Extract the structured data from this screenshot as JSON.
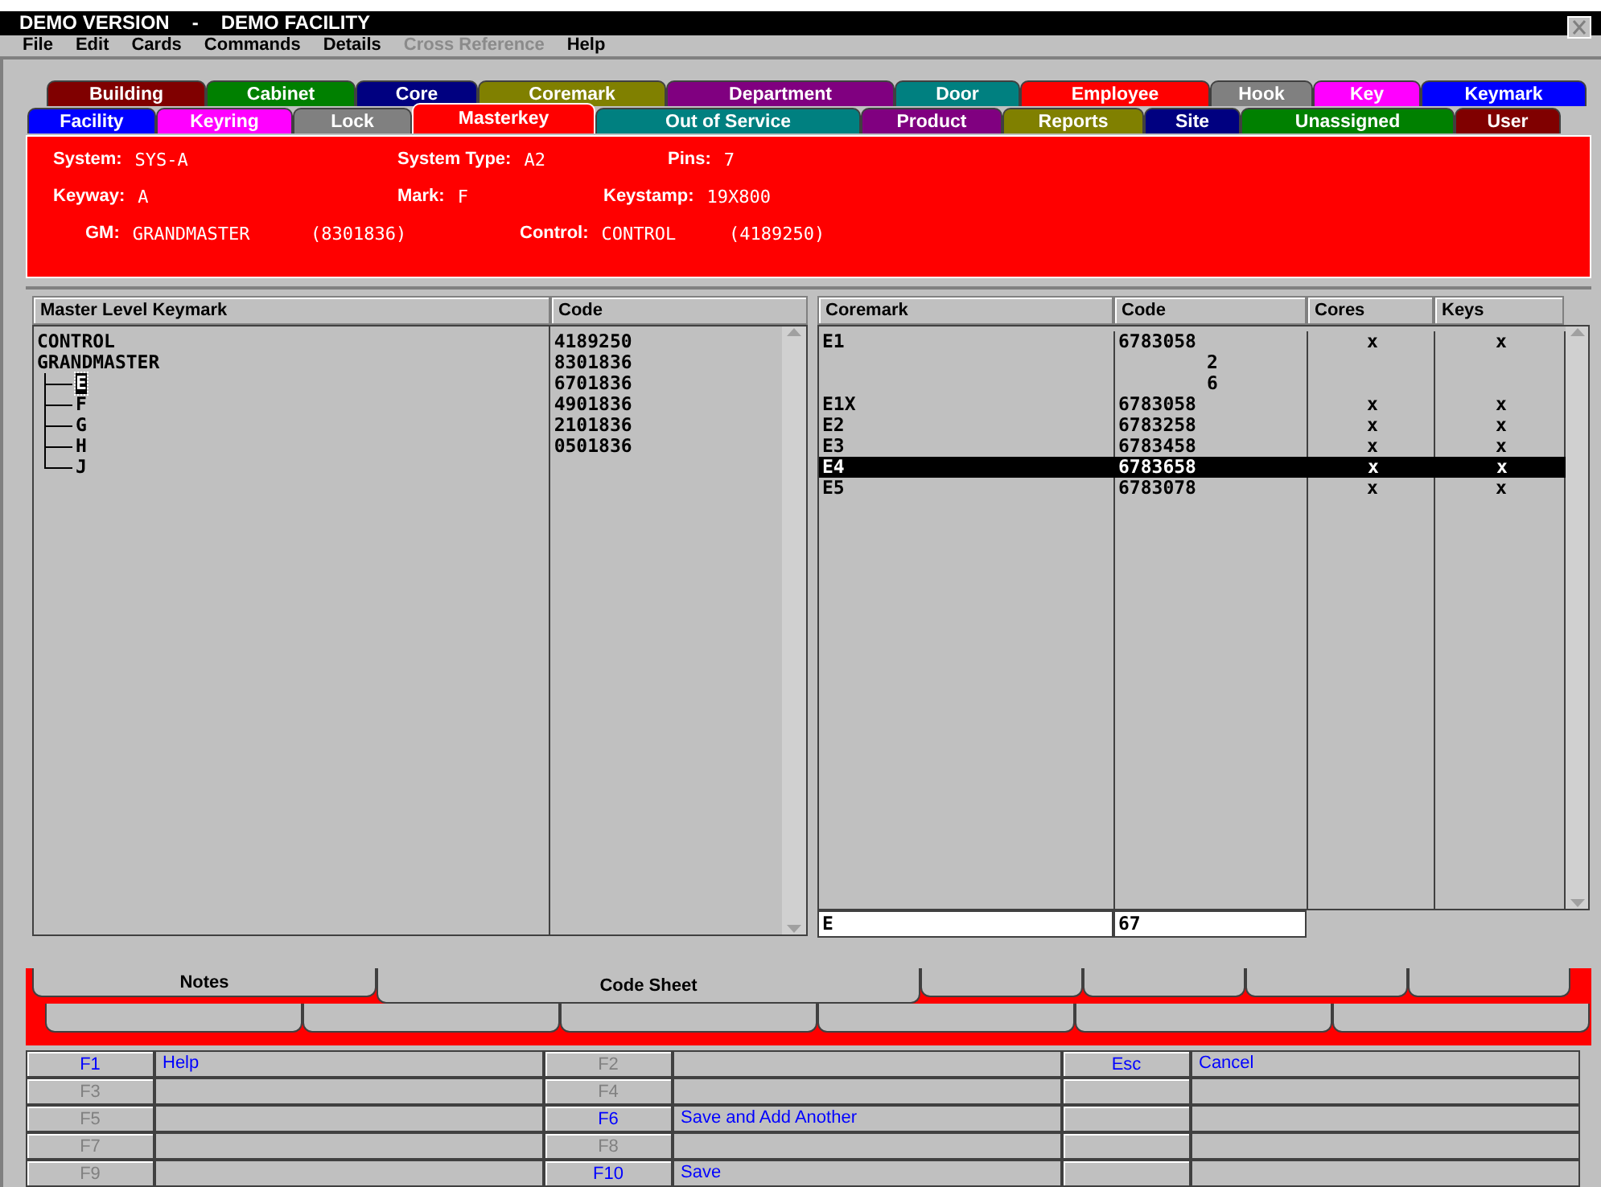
{
  "window": {
    "title_left": "DEMO VERSION",
    "separator": "-",
    "title_right": "DEMO FACILITY"
  },
  "menu": [
    {
      "label": "File",
      "disabled": false
    },
    {
      "label": "Edit",
      "disabled": false
    },
    {
      "label": "Cards",
      "disabled": false
    },
    {
      "label": "Commands",
      "disabled": false
    },
    {
      "label": "Details",
      "disabled": false
    },
    {
      "label": "Cross Reference",
      "disabled": true
    },
    {
      "label": "Help",
      "disabled": false
    }
  ],
  "tab_rows": [
    [
      {
        "label": "Building",
        "color": "#800000",
        "selected": false
      },
      {
        "label": "Cabinet",
        "color": "#008000",
        "selected": false
      },
      {
        "label": "Core",
        "color": "#000080",
        "selected": false
      },
      {
        "label": "Coremark",
        "color": "#808000",
        "selected": false
      },
      {
        "label": "Department",
        "color": "#800080",
        "selected": false
      },
      {
        "label": "Door",
        "color": "#008080",
        "selected": false
      },
      {
        "label": "Employee",
        "color": "#ff0000",
        "selected": false
      },
      {
        "label": "Hook",
        "color": "#808080",
        "selected": false
      },
      {
        "label": "Key",
        "color": "#ff00ff",
        "selected": false
      },
      {
        "label": "Keymark",
        "color": "#0000ff",
        "selected": false
      }
    ],
    [
      {
        "label": "Facility",
        "color": "#0000ff",
        "selected": false
      },
      {
        "label": "Keyring",
        "color": "#ff00ff",
        "selected": false
      },
      {
        "label": "Lock",
        "color": "#808080",
        "selected": false
      },
      {
        "label": "Masterkey",
        "color": "#ff0000",
        "selected": true
      },
      {
        "label": "Out of Service",
        "color": "#008080",
        "selected": false
      },
      {
        "label": "Product",
        "color": "#800080",
        "selected": false
      },
      {
        "label": "Reports",
        "color": "#808000",
        "selected": false
      },
      {
        "label": "Site",
        "color": "#000080",
        "selected": false
      },
      {
        "label": "Unassigned",
        "color": "#008000",
        "selected": false
      },
      {
        "label": "User",
        "color": "#800000",
        "selected": false
      }
    ]
  ],
  "info": [
    [
      {
        "label": "System:",
        "value": "SYS-A"
      },
      {
        "label": "System Type:",
        "value": "A2"
      },
      {
        "label": "Pins:",
        "value": "7"
      }
    ],
    [
      {
        "label": "Keyway:",
        "value": "A"
      },
      {
        "label": "Mark:",
        "value": "F"
      },
      {
        "label": "Keystamp:",
        "value": "19X800"
      }
    ],
    [
      {
        "label": "GM:",
        "value": "GRANDMASTER",
        "code": "(8301836)"
      },
      {
        "label": "Control:",
        "value": "CONTROL",
        "code": "(4189250)"
      }
    ]
  ],
  "keymark_list": {
    "columns": [
      "Master Level Keymark",
      "Code"
    ],
    "tree": [
      {
        "name": "CONTROL",
        "code": "4189250",
        "selected": false
      },
      {
        "name": "GRANDMASTER",
        "code": "8301836",
        "selected": false,
        "children": [
          {
            "name": "E",
            "code": "6701836",
            "selected": true
          },
          {
            "name": "F",
            "code": "4901836",
            "selected": false
          },
          {
            "name": "G",
            "code": "2101836",
            "selected": false
          },
          {
            "name": "H",
            "code": "0501836",
            "selected": false
          },
          {
            "name": "J",
            "selected": false
          }
        ]
      }
    ]
  },
  "coremark_table": {
    "columns": [
      "Coremark",
      "Code",
      "Cores",
      "Keys"
    ],
    "rows": [
      {
        "coremark": "E1",
        "code": "6783058",
        "cores": "x",
        "keys": "x",
        "selected": false
      },
      {
        "code": "2",
        "selected": false
      },
      {
        "code": "6",
        "selected": false
      },
      {
        "coremark": "E1X",
        "code": "6783058",
        "cores": "x",
        "keys": "x",
        "selected": false
      },
      {
        "coremark": "E2",
        "code": "6783258",
        "cores": "x",
        "keys": "x",
        "selected": false
      },
      {
        "coremark": "E3",
        "code": "6783458",
        "cores": "x",
        "keys": "x",
        "selected": false
      },
      {
        "coremark": "E4",
        "code": "6783658",
        "cores": "x",
        "keys": "x",
        "selected": true
      },
      {
        "coremark": "E5",
        "code": "6783078",
        "cores": "x",
        "keys": "x",
        "selected": false
      }
    ],
    "entry": {
      "coremark": "E",
      "code": "67"
    }
  },
  "bottom_tabs": [
    {
      "label": "Notes",
      "selected": false
    },
    {
      "label": "Code Sheet",
      "selected": true
    }
  ],
  "function_keys": [
    [
      {
        "key": "F1",
        "action": "Help",
        "disabled": false
      },
      {
        "key": "F2",
        "disabled": true
      },
      {
        "key": "Esc",
        "action": "Cancel",
        "disabled": false
      }
    ],
    [
      {
        "key": "F3",
        "disabled": true
      },
      {
        "key": "F4",
        "disabled": true
      }
    ],
    [
      {
        "key": "F5",
        "disabled": true
      },
      {
        "key": "F6",
        "action": "Save and Add Another",
        "disabled": false
      }
    ],
    [
      {
        "key": "F7",
        "disabled": true
      },
      {
        "key": "F8",
        "disabled": true
      }
    ],
    [
      {
        "key": "F9",
        "disabled": true
      },
      {
        "key": "F10",
        "action": "Save",
        "disabled": false
      }
    ]
  ]
}
